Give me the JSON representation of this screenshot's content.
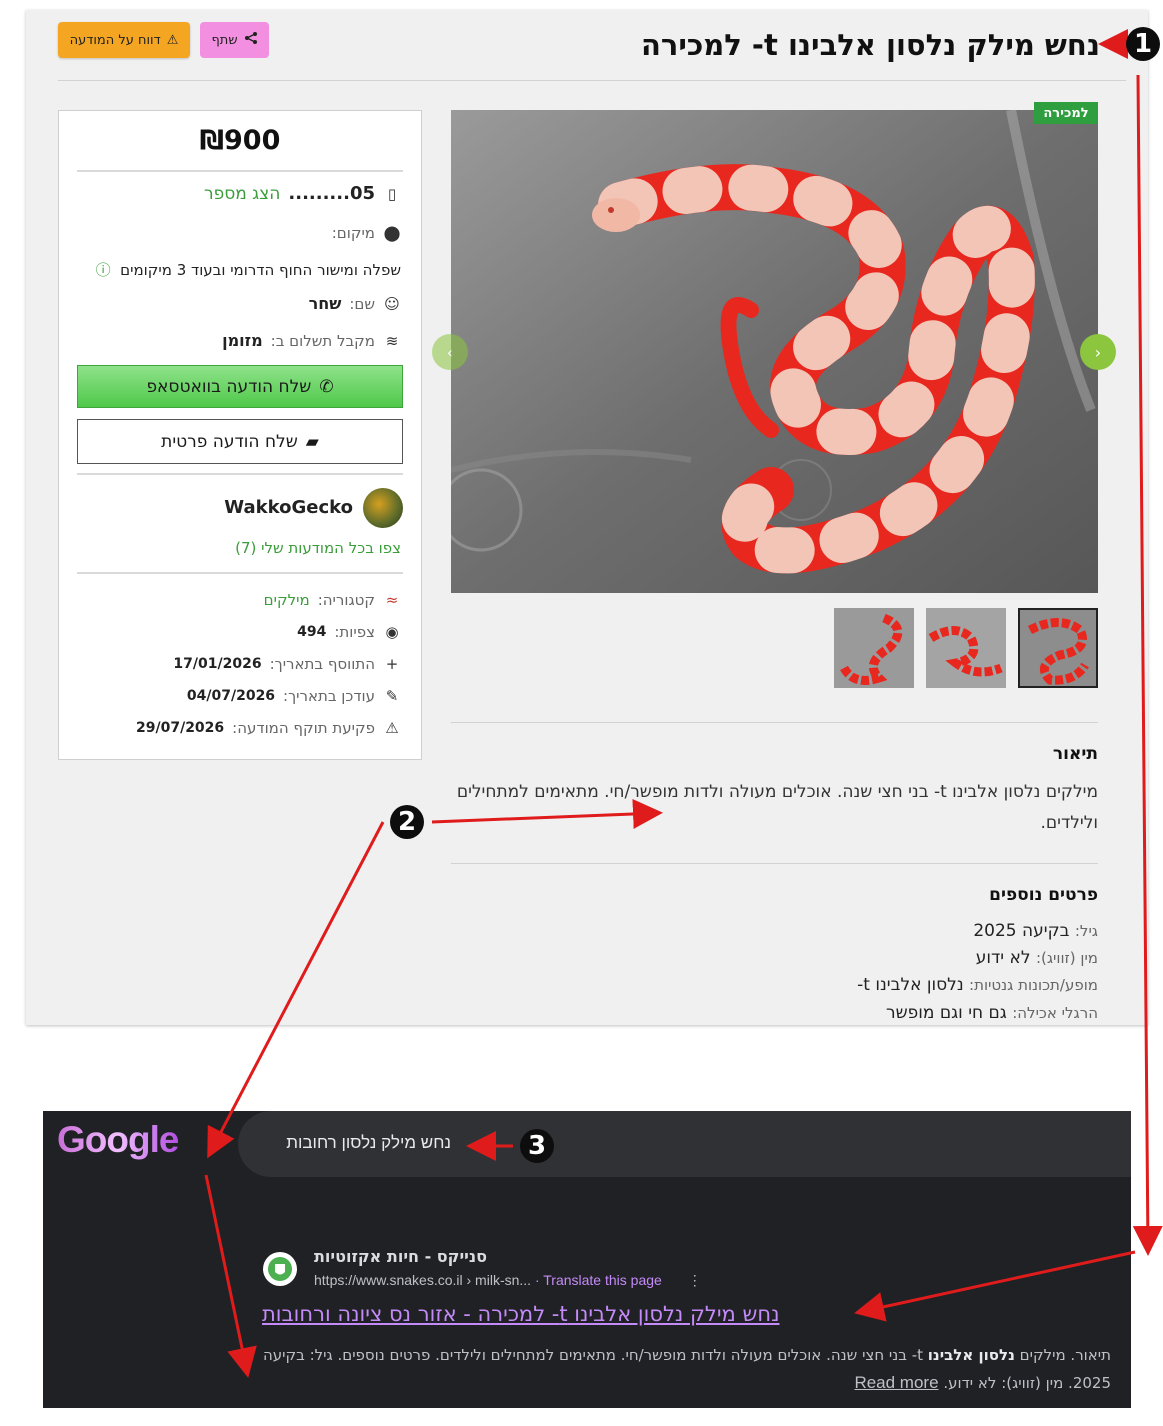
{
  "listing": {
    "title": "נחש מילק נלסון אלבינו t- למכירה",
    "share_label": "שתף",
    "report_label": "דווח על המודעה",
    "badge": "למכירה",
    "description_heading": "תיאור",
    "description": "מילקים נלסון אלבינו t- בני חצי שנה. אוכלים מעולה ולדות מופשר/חי. מתאימים למתחילים ולילדים.",
    "details_heading": "פרטים נוספים",
    "details": [
      {
        "label": "גיל:",
        "value": "בקיעה 2025"
      },
      {
        "label": "מין (זוויג):",
        "value": "לא ידוע"
      },
      {
        "label": "מופע/תכונות גנטיות:",
        "value": "נלסון אלבינו t-"
      },
      {
        "label": "הרגלי אכילה:",
        "value": "גם חי וגם מופשר"
      }
    ]
  },
  "card": {
    "price": "₪900",
    "phone": "05.........",
    "show_number": "הצג מספר",
    "location_label": "מיקום:",
    "location_value": "שפלה ומישור החוף הדרומי ובעוד 3 מיקומים",
    "name_label": "שם:",
    "name_value": "שחר",
    "payment_label": "מקבל תשלום ב:",
    "payment_value": "מזומן",
    "whatsapp_label": "שלח הודעה בוואטסאפ",
    "private_msg_label": "שלח הודעה פרטית",
    "seller_name": "WakkoGecko",
    "seller_link": "צפו בכל המודעות שלי (7)",
    "category_label": "קטגוריה:",
    "category_value": "מילקים",
    "views_label": "צפיות:",
    "views_value": "494",
    "added_label": "התווסף בתאריך:",
    "added_value": "17/01/2026",
    "updated_label": "עודכן בתאריך:",
    "updated_value": "04/07/2026",
    "expires_label": "פקיעת תוקף המודעה:",
    "expires_value": "29/07/2026"
  },
  "annotations": {
    "n1": "1",
    "n2": "2",
    "n3": "3"
  },
  "google": {
    "logo": "Google",
    "query": "נחש מילק נלסון רחובות",
    "site_name": "סנייקס - חיות אקזוטיות",
    "url": "https://www.snakes.co.il › milk-sn...",
    "translate": "· Translate this page",
    "result_title": "נחש מילק נלסון אלבינו t- למכירה - אזור נס ציונה ורחובות",
    "snippet_pre": "תיאור. מילקים ",
    "snippet_bold": "נלסון אלבינו",
    "snippet_post": " t- בני חצי שנה. אוכלים מעולה ולדות מופשר/חי. מתאימים למתחילים ולילדים. פרטים נוספים. גיל: בקיעה 2025. מין (זוויג): לא ידוע.",
    "read_more": "Read more"
  },
  "colors": {
    "accent_green": "#8cc63f",
    "report_orange": "#f4a623",
    "share_pink": "#f28fe0",
    "google_bg": "#202124",
    "link_purple": "#c58af9",
    "arrow_red": "#e01b1b"
  }
}
